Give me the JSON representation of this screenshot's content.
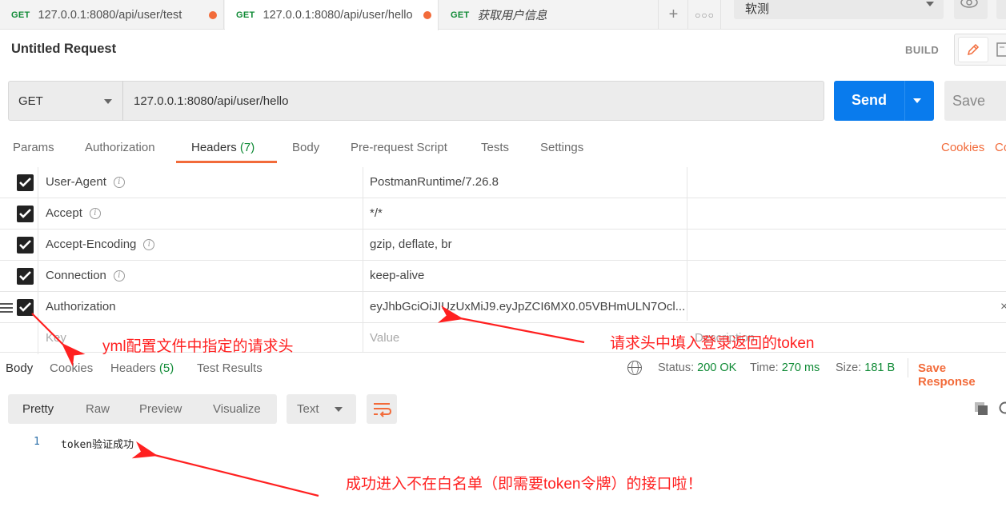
{
  "tabs": [
    {
      "method": "GET",
      "label": "127.0.0.1:8080/api/user/test",
      "unsaved": true
    },
    {
      "method": "GET",
      "label": "127.0.0.1:8080/api/user/hello",
      "unsaved": true
    },
    {
      "method": "GET",
      "label": "获取用户信息",
      "unsaved": false
    }
  ],
  "environment": {
    "selected": "软测"
  },
  "request": {
    "title": "Untitled Request",
    "mode_label": "BUILD",
    "method": "GET",
    "url": "127.0.0.1:8080/api/user/hello",
    "send_label": "Send",
    "save_label": "Save"
  },
  "request_tabs": {
    "params": "Params",
    "authorization": "Authorization",
    "headers": "Headers",
    "headers_count": "(7)",
    "body": "Body",
    "prerequest": "Pre-request Script",
    "tests": "Tests",
    "settings": "Settings",
    "cookies": "Cookies",
    "code": "Co"
  },
  "headers": [
    {
      "key": "User-Agent",
      "value": "PostmanRuntime/7.26.8"
    },
    {
      "key": "Accept",
      "value": "*/*"
    },
    {
      "key": "Accept-Encoding",
      "value": "gzip, deflate, br"
    },
    {
      "key": "Connection",
      "value": "keep-alive"
    },
    {
      "key": "Authorization",
      "value": "eyJhbGciOiJIUzUxMiJ9.eyJpZCI6MX0.05VBHmULN7Ocl..."
    }
  ],
  "new_header": {
    "key_placeholder": "Key",
    "value_placeholder": "Value",
    "desc_placeholder": "Description"
  },
  "response": {
    "tabs": {
      "body": "Body",
      "cookies": "Cookies",
      "headers": "Headers",
      "headers_count": "(5)",
      "test_results": "Test Results"
    },
    "status_label": "Status:",
    "status_value": "200 OK",
    "time_label": "Time:",
    "time_value": "270 ms",
    "size_label": "Size:",
    "size_value": "181 B",
    "save_label": "Save Response",
    "views": {
      "pretty": "Pretty",
      "raw": "Raw",
      "preview": "Preview",
      "visualize": "Visualize"
    },
    "format": "Text",
    "body_lines": [
      {
        "num": "1",
        "text": "token验证成功"
      }
    ]
  },
  "annotations": {
    "header_note": "yml配置文件中指定的请求头",
    "token_note": "请求头中填入登录返回的token",
    "success_note": "成功进入不在白名单（即需要token令牌）的接口啦！"
  },
  "colors": {
    "accent": "#f26b3a",
    "send": "#097bed",
    "method_get": "#0f8a35",
    "annotation": "#ff2020"
  }
}
